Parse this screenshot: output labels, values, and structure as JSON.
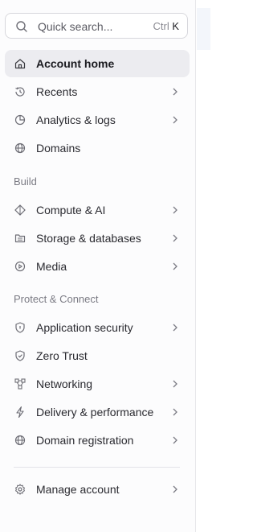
{
  "search": {
    "placeholder": "Quick search...",
    "shortcut_mod": "Ctrl",
    "shortcut_key": "K",
    "icon": "search-icon"
  },
  "nav": {
    "account_home": {
      "label": "Account home",
      "icon": "home-icon",
      "active": true
    },
    "recents": {
      "label": "Recents",
      "icon": "history-icon"
    },
    "analytics": {
      "label": "Analytics & logs",
      "icon": "pie-chart-icon"
    },
    "domains": {
      "label": "Domains",
      "icon": "globe-icon"
    }
  },
  "sections": {
    "build": "Build",
    "protect": "Protect & Connect"
  },
  "build_items": {
    "compute": {
      "label": "Compute & AI",
      "icon": "compute-icon"
    },
    "storage": {
      "label": "Storage & databases",
      "icon": "storage-icon"
    },
    "media": {
      "label": "Media",
      "icon": "play-icon"
    }
  },
  "protect_items": {
    "app_security": {
      "label": "Application security",
      "icon": "shield-icon"
    },
    "zero_trust": {
      "label": "Zero Trust",
      "icon": "zero-trust-icon"
    },
    "networking": {
      "label": "Networking",
      "icon": "network-icon"
    },
    "delivery": {
      "label": "Delivery & performance",
      "icon": "bolt-icon"
    },
    "domain_registration": {
      "label": "Domain registration",
      "icon": "globe-icon"
    }
  },
  "footer": {
    "manage_account": {
      "label": "Manage account",
      "icon": "gear-icon"
    }
  },
  "colors": {
    "active_bg": "#ececf0",
    "text": "#2a2a30",
    "muted": "#7b7b84",
    "icon": "#6e6e76"
  }
}
